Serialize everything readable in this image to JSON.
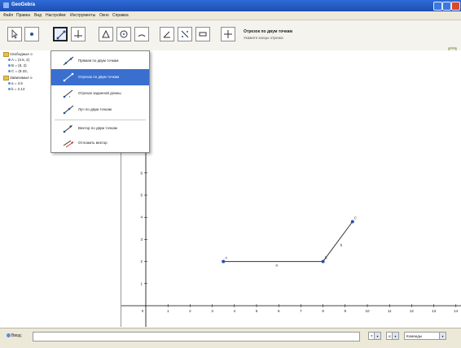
{
  "window": {
    "title": "GeoGebra"
  },
  "menu": [
    "Файл",
    "Правка",
    "Вид",
    "Настройки",
    "Инструменты",
    "Окно",
    "Справка"
  ],
  "toolbar": {
    "active_tool_name": "Отрезок по двум точкам",
    "active_tool_hint": "Укажите концы отрезка"
  },
  "algebra": {
    "free_header": "Свободные о",
    "free": [
      {
        "label": "A = (3.5, 2)"
      },
      {
        "label": "B = (8, 2)"
      },
      {
        "label": "C = (9.33,"
      }
    ],
    "dep_header": "Зависимые о",
    "dep": [
      {
        "label": "a = 4.5"
      },
      {
        "label": "b = 2.14"
      }
    ]
  },
  "dropdown": {
    "items": [
      {
        "label": "Прямая по двум точкам"
      },
      {
        "label": "Отрезок по двум точкам"
      },
      {
        "label": "Отрезок заданной длины"
      },
      {
        "label": "Луч по двум точкам"
      },
      {
        "label": "Вектор по двум точкам"
      },
      {
        "label": "Отложить вектор"
      }
    ],
    "selected_index": 1
  },
  "graphics": {
    "x_ticks": [
      "0",
      "1",
      "2",
      "3",
      "4",
      "5",
      "6",
      "7",
      "8",
      "9",
      "10",
      "11",
      "12",
      "13",
      "14"
    ],
    "y_ticks": [
      "1",
      "2",
      "3",
      "4",
      "5",
      "6",
      "7",
      "8"
    ],
    "points": [
      {
        "name": "A",
        "x": 3.5,
        "y": 2
      },
      {
        "name": "B",
        "x": 8,
        "y": 2
      },
      {
        "name": "C",
        "x": 9.33,
        "y": 3.8
      }
    ],
    "segments": [
      {
        "name": "a",
        "from": "A",
        "to": "B"
      },
      {
        "name": "b",
        "from": "B",
        "to": "C"
      }
    ]
  },
  "inputbar": {
    "help_label": "Ввод:",
    "font_size_select": "7",
    "alpha_select": "α",
    "command_select": "Команды"
  },
  "colors": {
    "accent": "#3a6fcf",
    "point": "#2a4fa8",
    "line": "#333333"
  }
}
